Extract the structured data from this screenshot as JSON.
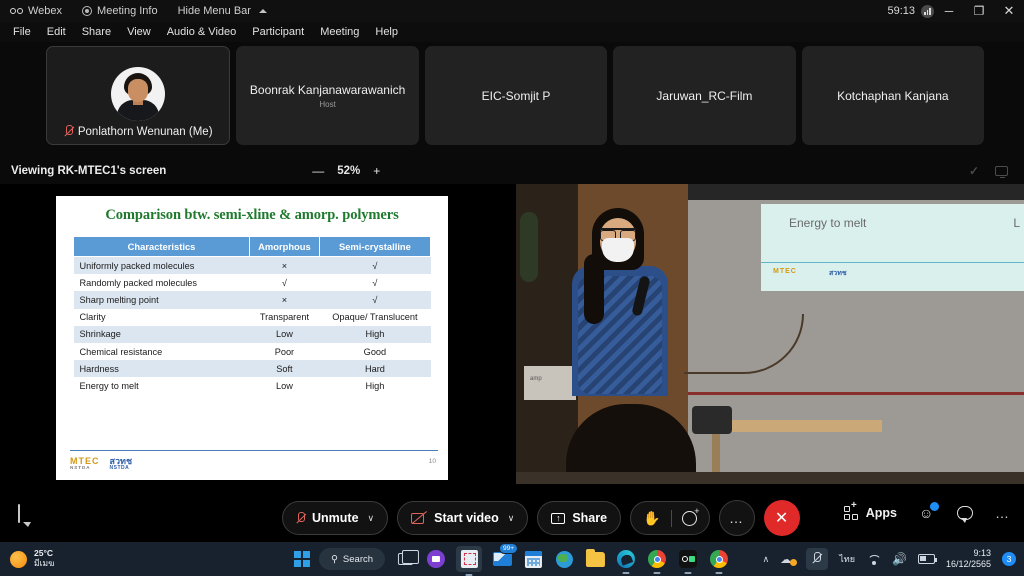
{
  "titlebar": {
    "app_name": "Webex",
    "meeting_info": "Meeting Info",
    "hide_menu_bar": "Hide Menu Bar",
    "timer": "59:13",
    "minimize": "─",
    "maximize": "❐",
    "close": "✕"
  },
  "menubar": {
    "items": [
      {
        "label": "File"
      },
      {
        "label": "Edit"
      },
      {
        "label": "Share"
      },
      {
        "label": "View"
      },
      {
        "label": "Audio & Video"
      },
      {
        "label": "Participant"
      },
      {
        "label": "Meeting"
      },
      {
        "label": "Help"
      }
    ]
  },
  "participants": [
    {
      "name": "Ponlathorn Wenunan (Me)",
      "role": "",
      "self": true,
      "muted": true
    },
    {
      "name": "Boonrak Kanjanawarawanich",
      "role": "Host",
      "self": false,
      "muted": false
    },
    {
      "name": "EIC-Somjit P",
      "role": "",
      "self": false,
      "muted": false
    },
    {
      "name": "Jaruwan_RC-Film",
      "role": "",
      "self": false,
      "muted": false
    },
    {
      "name": "Kotchaphan Kanjana",
      "role": "",
      "self": false,
      "muted": false
    }
  ],
  "viewbar": {
    "title": "Viewing RK-MTEC1's screen",
    "zoom_out": "—",
    "zoom_level": "52%",
    "zoom_in": "+"
  },
  "slide": {
    "title": "Comparison btw. semi-xline & amorp. polymers",
    "headers": [
      "Characteristics",
      "Amorphous",
      "Semi-crystalline"
    ],
    "rows": [
      [
        "Uniformly packed molecules",
        "×",
        "√"
      ],
      [
        "Randomly packed molecules",
        "√",
        "√"
      ],
      [
        "Sharp melting point",
        "×",
        "√"
      ],
      [
        "Clarity",
        "Transparent",
        "Opaque/ Translucent"
      ],
      [
        "Shrinkage",
        "Low",
        "High"
      ],
      [
        "Chemical resistance",
        "Poor",
        "Good"
      ],
      [
        "Hardness",
        "Soft",
        "Hard"
      ],
      [
        "Energy to melt",
        "Low",
        "High"
      ]
    ],
    "logo_primary": "MTEC",
    "logo_primary_sub": "NSTDA",
    "logo_secondary": "สวทช",
    "logo_secondary_sub": "NSTDA",
    "page_number": "10"
  },
  "video": {
    "projected_title": "Energy to melt",
    "projected_right": "L",
    "projected_logo": "MTEC",
    "projected_logo2": "สวทช",
    "equipment_label": "amp"
  },
  "controls": {
    "unmute": "Unmute",
    "start_video": "Start video",
    "share": "Share",
    "chevron": "∨",
    "share_glyph": "↑",
    "hand_glyph": "✋",
    "more": "…",
    "end_call": "✕",
    "apps": "Apps",
    "right_more": "…"
  },
  "taskbar": {
    "weather_temp": "25°C",
    "weather_desc": "มีเมฆ",
    "search_placeholder": "Search",
    "mail_badge": "99+",
    "tray_language": "ไทย",
    "clock_time": "9:13",
    "clock_date": "16/12/2565",
    "notification_count": "3",
    "chevron_up": "∧"
  },
  "colors": {
    "accent_blue": "#5b9bd5",
    "title_green": "#1f7a2e",
    "row_alt": "#dce6f1",
    "end_call_red": "#e02a2a",
    "taskbar_bg": "#18222e"
  }
}
